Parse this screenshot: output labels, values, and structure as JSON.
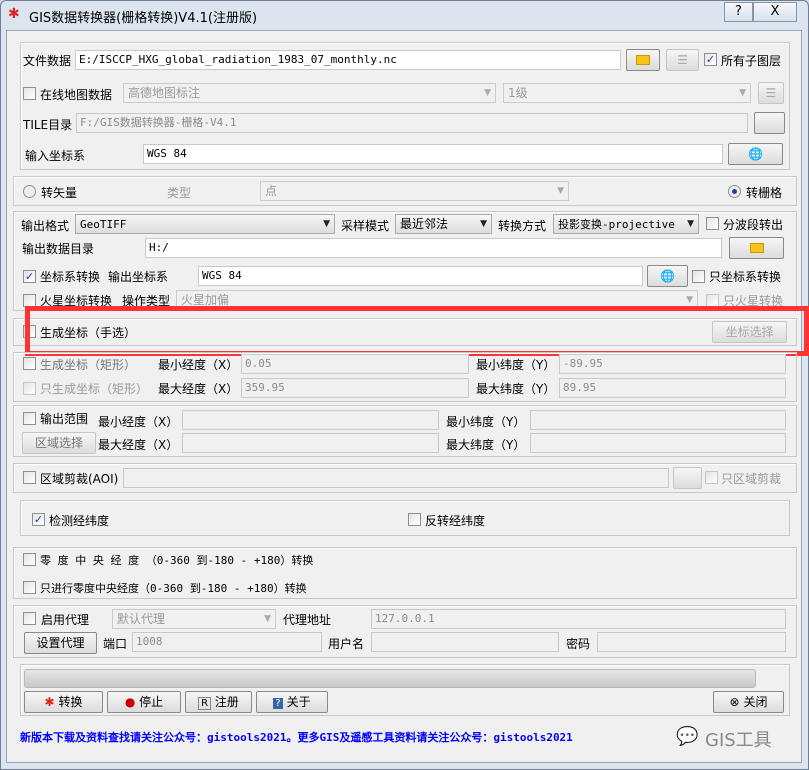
{
  "window": {
    "title": "GIS数据转换器(栅格转换)V4.1(注册版)",
    "help": "?",
    "close": "X"
  },
  "input": {
    "file_label": "文件数据",
    "file_value": "E:/ISCCP_HXG_global_radiation_1983_07_monthly.nc",
    "all_sublayers": "所有子图层",
    "all_sublayers_checked": true,
    "online_label": "在线地图数据",
    "online_source": "高德地图标注",
    "online_level": "1级",
    "tile_label": "TILE目录",
    "tile_value": "F:/GIS数据转换器-栅格-V4.1",
    "crs_label": "输入坐标系",
    "crs_value": "WGS 84"
  },
  "mode": {
    "vector_label": "转矢量",
    "type_label": "类型",
    "type_value": "点",
    "raster_label": "转栅格",
    "selected": "raster"
  },
  "output": {
    "format_label": "输出格式",
    "format_value": "GeoTIFF",
    "sampling_label": "采样模式",
    "sampling_value": "最近邻法",
    "method_label": "转换方式",
    "method_value": "投影变换-projective",
    "split_bands": "分波段转出",
    "dir_label": "输出数据目录",
    "dir_value": "H:/",
    "crs_convert": "坐标系转换",
    "crs_convert_checked": true,
    "out_crs_label": "输出坐标系",
    "out_crs_value": "WGS 84",
    "only_crs": "只坐标系转换",
    "mars_convert": "火星坐标转换",
    "op_type_label": "操作类型",
    "op_type_value": "火星加偏",
    "only_mars": "只火星转换"
  },
  "manual": {
    "label": "生成坐标（手选）",
    "button": "坐标选择"
  },
  "rect": {
    "gen_label": "生成坐标（矩形）",
    "only_gen_label": "只生成坐标（矩形）",
    "min_lon_label": "最小经度（X）",
    "min_lon": "0.05",
    "max_lon_label": "最大经度（X）",
    "max_lon": "359.95",
    "min_lat_label": "最小纬度（Y）",
    "min_lat": "-89.95",
    "max_lat_label": "最大纬度（Y）",
    "max_lat": "89.95"
  },
  "extent": {
    "label": "输出范围",
    "region_button": "区域选择",
    "min_lon_label": "最小经度（X）",
    "max_lon_label": "最大经度（X）",
    "min_lat_label": "最小纬度（Y）",
    "max_lat_label": "最大纬度（Y）"
  },
  "aoi": {
    "label": "区域剪裁(AOI)",
    "only_label": "只区域剪裁"
  },
  "lat": {
    "check_label": "检测经纬度",
    "check_checked": true,
    "flip_label": "反转经纬度"
  },
  "meridian": {
    "zero_label": "零 度 中 央 经 度 （0-360 到-180 - +180）转换",
    "only_label": "只进行零度中央经度（0-360 到-180 - +180）转换"
  },
  "proxy": {
    "enable_label": "启用代理",
    "type_value": "默认代理",
    "addr_label": "代理地址",
    "addr_value": "127.0.0.1",
    "set_button": "设置代理",
    "port_label": "端口",
    "port_value": "1008",
    "user_label": "用户名",
    "pass_label": "密码"
  },
  "actions": {
    "progress": 0,
    "convert": "转换",
    "stop": "停止",
    "register": "注册",
    "about": "关于",
    "close": "关闭"
  },
  "footer": {
    "notice": "新版本下载及资料查找请关注公众号：gistools2021。更多GIS及遥感工具资料请关注公众号：gistools2021",
    "brand": "GIS工具",
    "notice_color": "#0000ff"
  },
  "highlight_color": "#ff3333"
}
